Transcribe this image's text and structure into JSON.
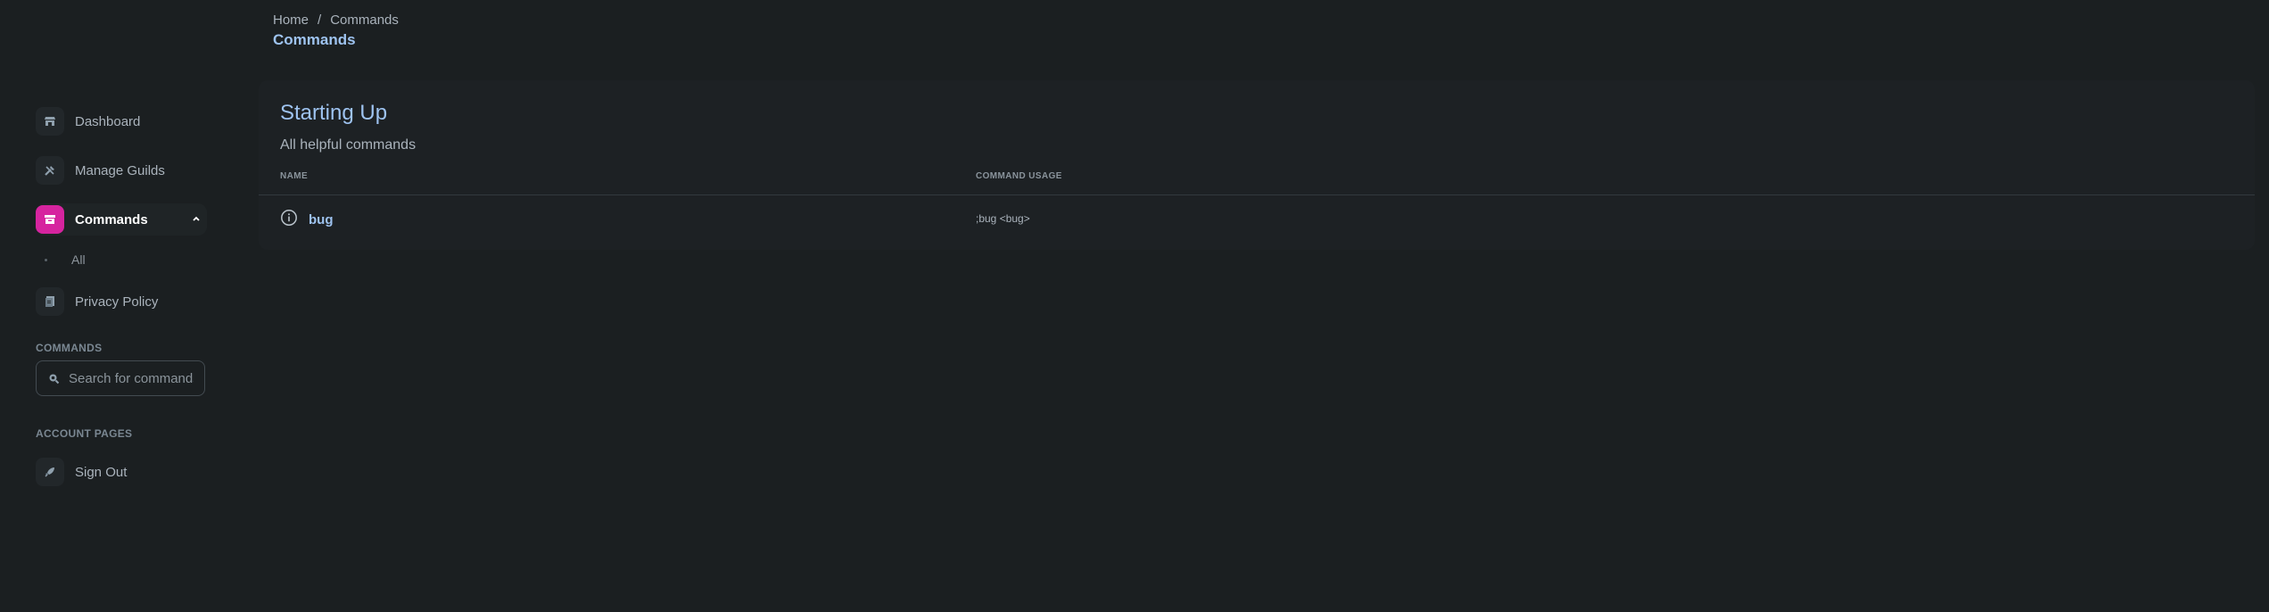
{
  "sidebar": {
    "nav": {
      "dashboard": "Dashboard",
      "manage_guilds": "Manage Guilds",
      "commands": "Commands",
      "all": "All",
      "privacy_policy": "Privacy Policy"
    },
    "commands_section": {
      "title": "COMMANDS",
      "search_placeholder": "Search for commands"
    },
    "account_section": {
      "title": "ACCOUNT PAGES",
      "sign_out": "Sign Out"
    }
  },
  "header": {
    "breadcrumb": [
      "Home",
      "Commands"
    ],
    "breadcrumb_separator": "/",
    "title": "Commands"
  },
  "card": {
    "title": "Starting Up",
    "subtitle": "All helpful commands",
    "columns": [
      "NAME",
      "COMMAND USAGE"
    ],
    "rows": [
      {
        "name": "bug",
        "usage": ";bug <bug>"
      }
    ]
  },
  "colors": {
    "background": "#1b1f21",
    "accent_active": "#d6249f",
    "link_blue": "#9ec3f0"
  }
}
